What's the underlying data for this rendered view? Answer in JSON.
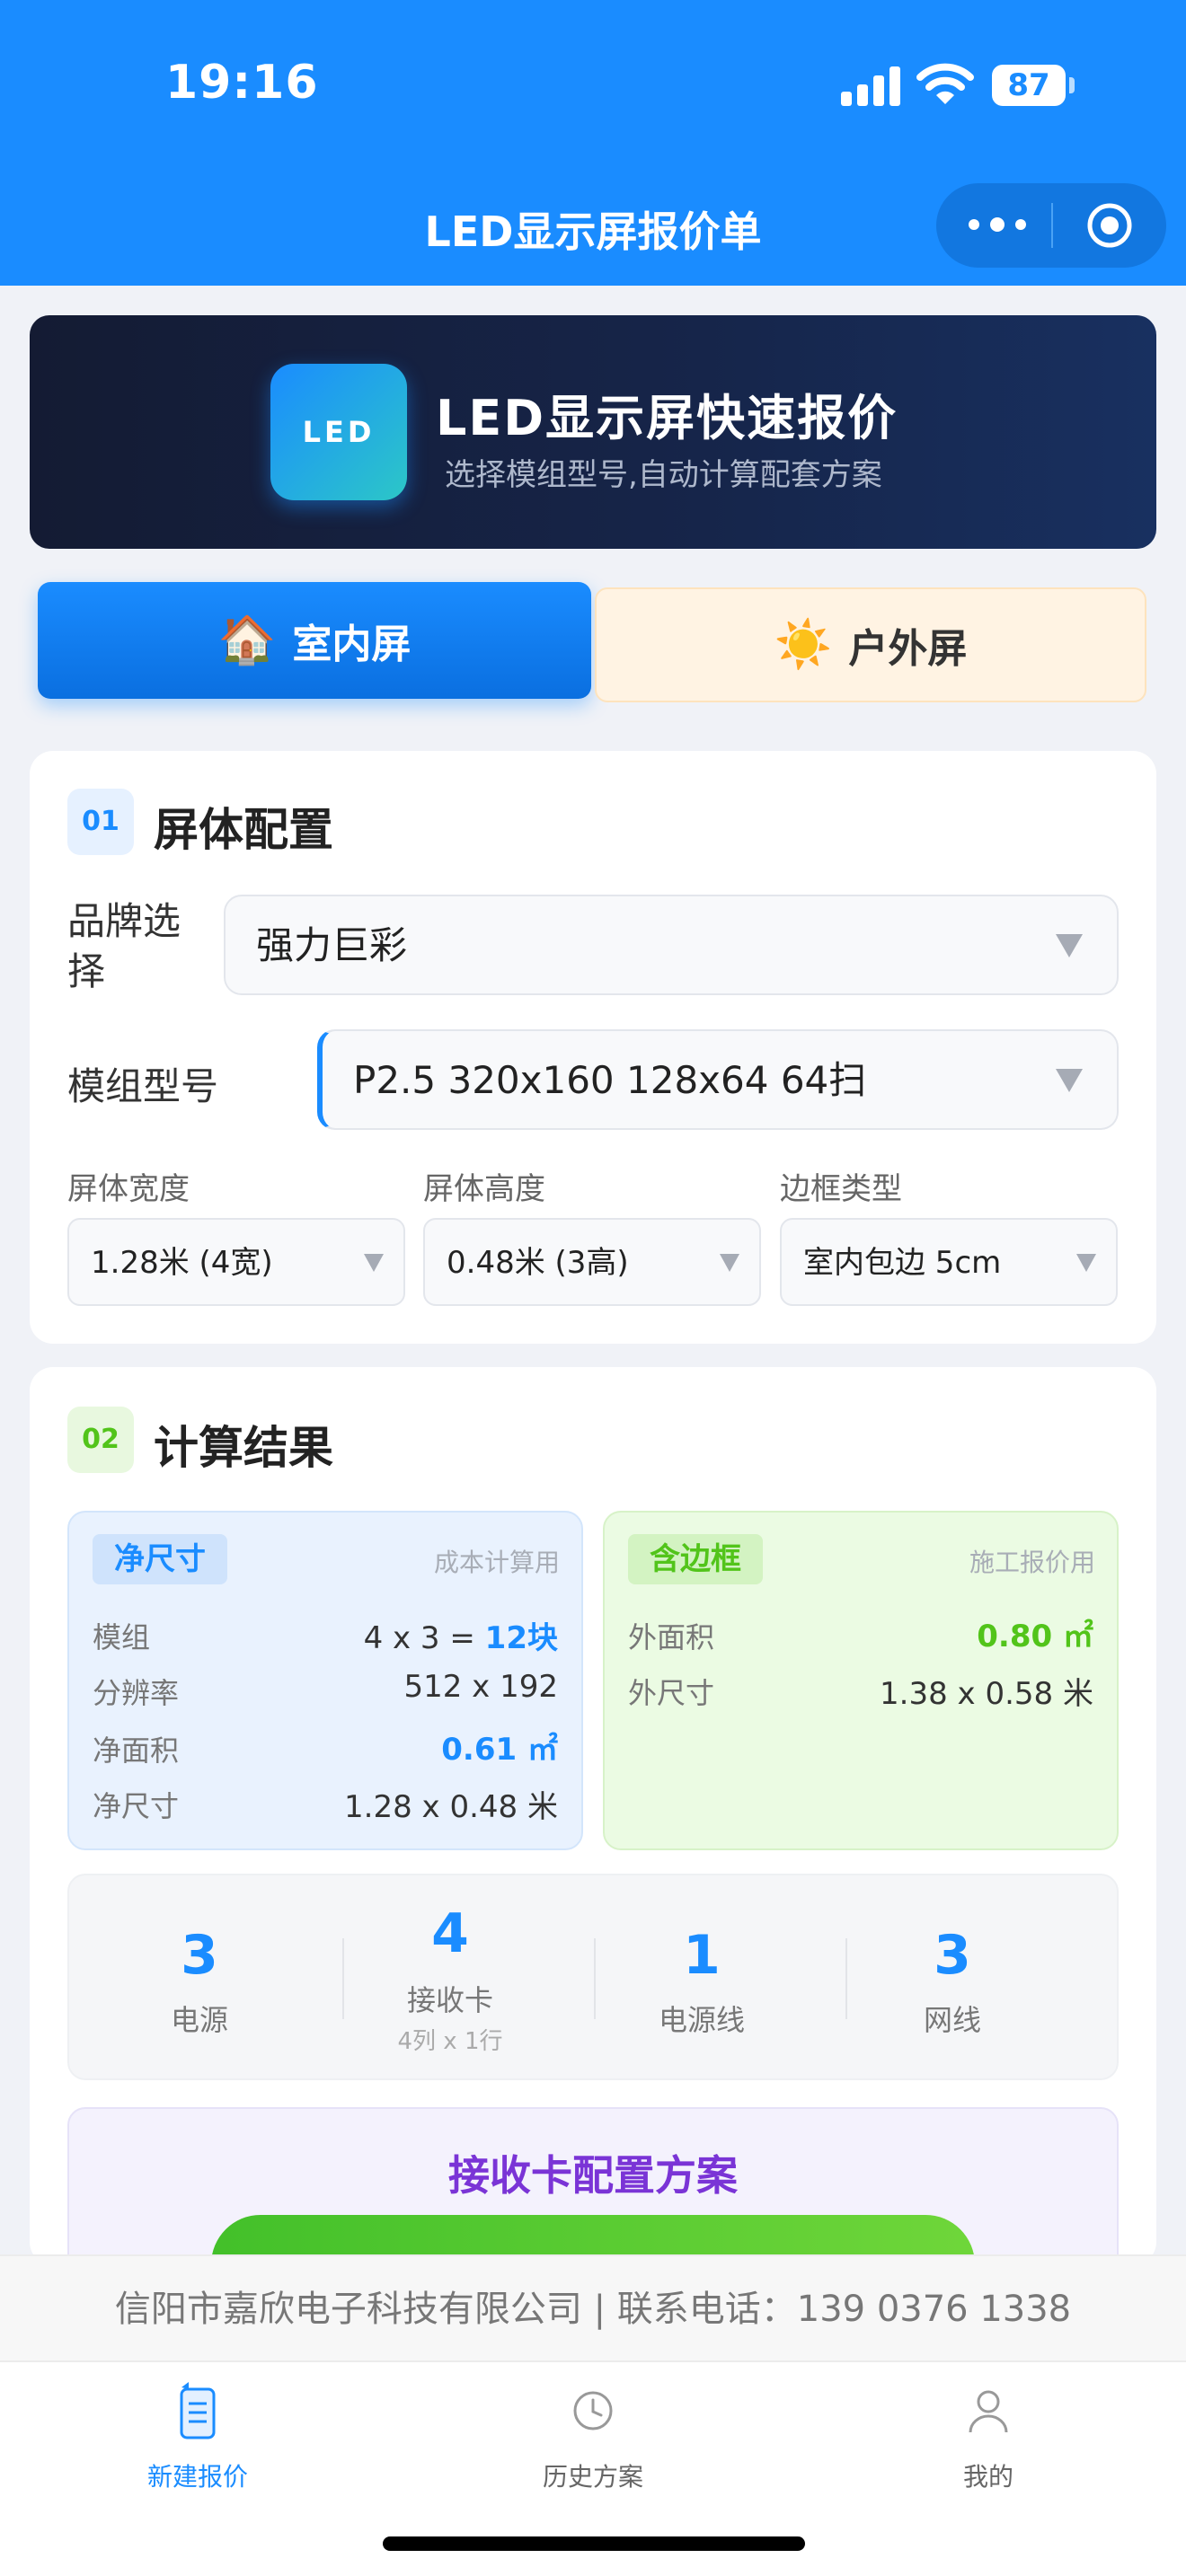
{
  "status_bar": {
    "time": "19:16",
    "battery": "87"
  },
  "nav": {
    "title": "LED显示屏报价单"
  },
  "banner": {
    "logo": "LED",
    "title": "LED显示屏快速报价",
    "subtitle": "选择模组型号,自动计算配套方案"
  },
  "tabs": [
    {
      "label": "室内屏",
      "icon": "🏠",
      "active": true
    },
    {
      "label": "户外屏",
      "icon": "☀️",
      "active": false
    }
  ],
  "config": {
    "number": "01",
    "title": "屏体配置",
    "brand_label": "品牌选择",
    "brand_label_l1": "品牌选",
    "brand_label_l2": "择",
    "brand_value": "强力巨彩",
    "module_label": "模组型号",
    "module_value": "P2.5 320x160 128x64 64扫",
    "width_label": "屏体宽度",
    "width_value": "1.28米 (4宽)",
    "height_label": "屏体高度",
    "height_value": "0.48米 (3高)",
    "frame_label": "边框类型",
    "frame_value": "室内包边 5cm"
  },
  "results": {
    "number": "02",
    "title": "计算结果",
    "net": {
      "badge": "净尺寸",
      "note": "成本计算用",
      "rows": [
        {
          "key": "模组",
          "prefix": "4 x 3 = ",
          "value": "12块"
        },
        {
          "key": "分辨率",
          "value": "512 x 192"
        },
        {
          "key": "净面积",
          "value": "0.61 ㎡"
        },
        {
          "key": "净尺寸",
          "value": "1.28 x 0.48 米"
        }
      ]
    },
    "frame": {
      "badge": "含边框",
      "note": "施工报价用",
      "rows": [
        {
          "key": "外面积",
          "value": "0.80 ㎡"
        },
        {
          "key": "外尺寸",
          "value": "1.38 x 0.58 米"
        }
      ]
    },
    "stats": [
      {
        "num": "3",
        "name": "电源"
      },
      {
        "num": "4",
        "name": "接收卡",
        "sub": "4列 x 1行"
      },
      {
        "num": "1",
        "name": "电源线"
      },
      {
        "num": "3",
        "name": "网线"
      }
    ],
    "plan_title": "接收卡配置方案"
  },
  "footer": {
    "info": "信阳市嘉欣电子科技有限公司 | 联系电话：139 0376 1338"
  },
  "tabbar": [
    {
      "label": "新建报价",
      "icon": "document-icon",
      "active": true
    },
    {
      "label": "历史方案",
      "icon": "clock-icon",
      "active": false
    },
    {
      "label": "我的",
      "icon": "user-icon",
      "active": false
    }
  ],
  "colors": {
    "primary": "#1a8cff",
    "green": "#52c41a",
    "purple": "#7a34d6",
    "banner_bg": "#141b33"
  }
}
